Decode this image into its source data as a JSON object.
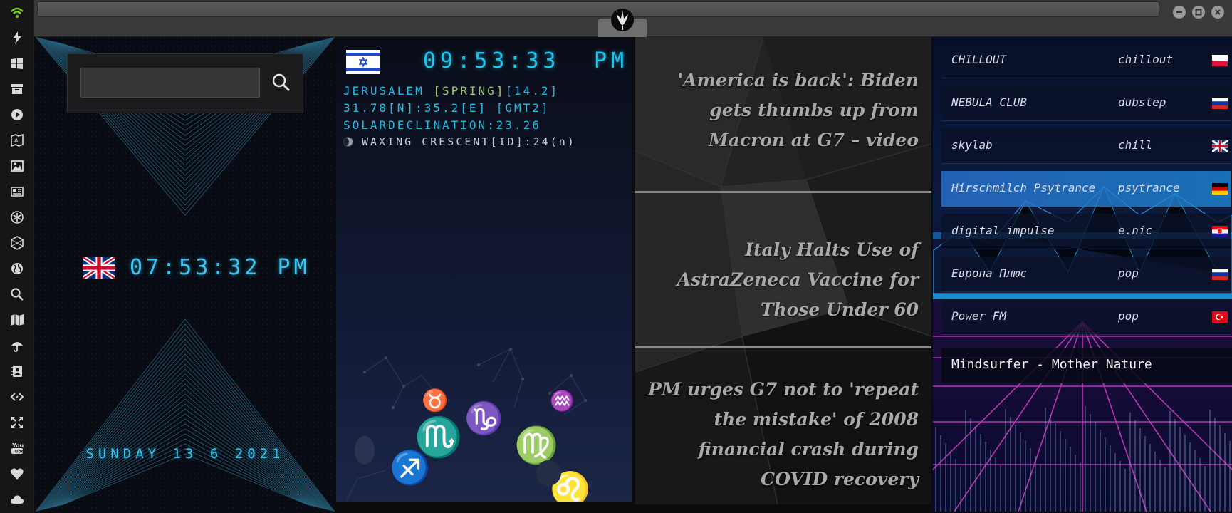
{
  "rail": {
    "icons": [
      "wifi-icon",
      "bolt-icon",
      "windows-icon",
      "archive-icon",
      "play-icon",
      "map-book-icon",
      "image-icon",
      "newspaper-icon",
      "settings-asterisk-icon",
      "hexagon-icon",
      "globe-icon",
      "search-icon",
      "map-icon",
      "umbrella-icon",
      "contacts-icon",
      "code-icon",
      "expand-icon",
      "youtube-icon",
      "heart-icon",
      "cloud-icon"
    ],
    "colors": {
      "wifi": "#7ed321",
      "default": "#d8d8d8"
    }
  },
  "clock": {
    "search": {
      "value": "",
      "placeholder": ""
    },
    "time": "07:53:32 PM",
    "date": "SUNDAY 13 6 2021",
    "accent": "#39c3ef"
  },
  "jerusalem": {
    "time": "09:53:33",
    "ampm": "PM",
    "city_prefix": "JERUSALEM ",
    "season": "[SPRING]",
    "city_suffix": "[14.2]",
    "coords": "31.78[N]:35.2[E] [GMT2]",
    "solar": "SOLARDECLINATION:23.26",
    "moon": "WAXING CRESCENT[ID]:24(n)"
  },
  "news": {
    "items": [
      "'America is back': Biden gets thumbs up from Macron at G7 – video",
      "Italy Halts Use of AstraZeneca Vaccine for Those Under 60",
      "PM urges G7 not to 'repeat the mistake' of 2008 financial crash during COVID recovery"
    ]
  },
  "radio": {
    "stations": [
      {
        "name": "CHILLOUT",
        "genre": "chillout",
        "flag": "poland-flag"
      },
      {
        "name": "NEBULA CLUB",
        "genre": "dubstep",
        "flag": "russia-flag"
      },
      {
        "name": "skylab",
        "genre": "chill",
        "flag": "uk-flag"
      },
      {
        "name": "Hirschmilch Psytrance",
        "genre": "psytrance",
        "flag": "germany-flag",
        "active": true
      },
      {
        "name": "digital impulse",
        "genre": "e.nic",
        "flag": "croatia-flag"
      },
      {
        "name": "Европа Плюс",
        "genre": "pop",
        "flag": "russia-flag"
      },
      {
        "name": "Power FM",
        "genre": "pop",
        "flag": "turkey-flag"
      }
    ],
    "now_playing": "Mindsurfer - Mother Nature"
  }
}
